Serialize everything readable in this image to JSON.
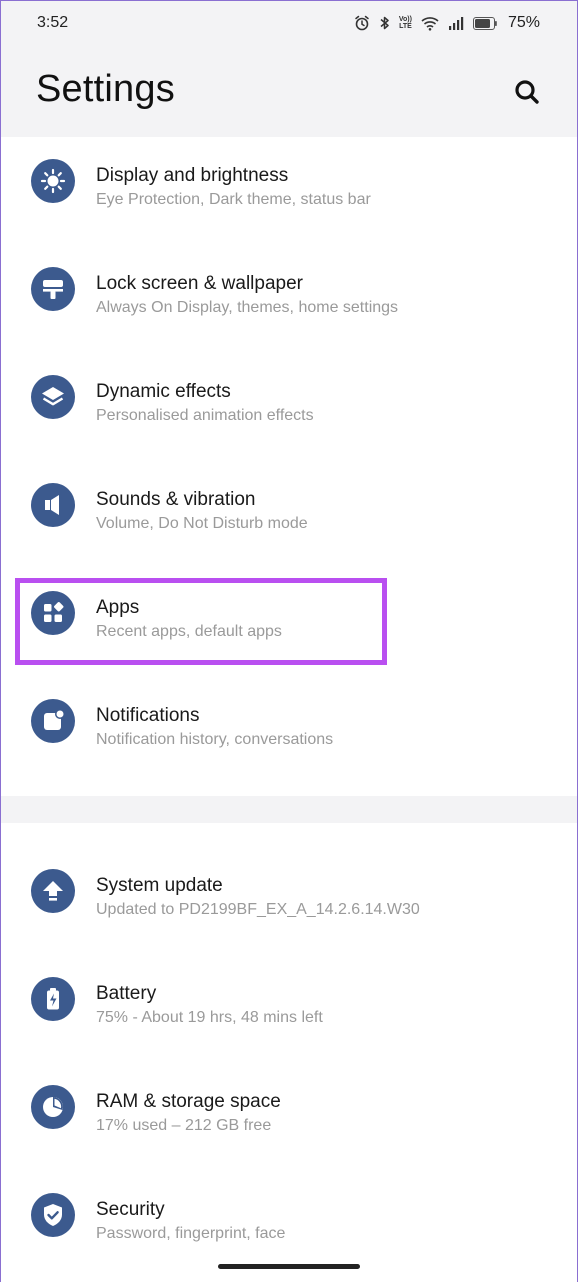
{
  "status_bar": {
    "time": "3:52",
    "volte_line1": "Vo))",
    "volte_line2": "LTE",
    "battery_percent": "75%",
    "icons": [
      "alarm-icon",
      "bluetooth-icon",
      "volte-icon",
      "wifi-icon",
      "signal-icon",
      "battery-icon"
    ]
  },
  "header": {
    "title": "Settings",
    "search_icon": "search-icon"
  },
  "settings_group_1": [
    {
      "title": "Display and brightness",
      "subtitle": "Eye Protection, Dark theme, status bar",
      "icon": "brightness-icon"
    },
    {
      "title": "Lock screen & wallpaper",
      "subtitle": "Always On Display, themes, home settings",
      "icon": "paint-roller-icon"
    },
    {
      "title": "Dynamic effects",
      "subtitle": "Personalised animation effects",
      "icon": "layers-icon"
    },
    {
      "title": "Sounds & vibration",
      "subtitle": "Volume, Do Not Disturb mode",
      "icon": "speaker-icon"
    },
    {
      "title": "Apps",
      "subtitle": "Recent apps, default apps",
      "icon": "apps-grid-icon"
    },
    {
      "title": "Notifications",
      "subtitle": "Notification history, conversations",
      "icon": "notification-badge-icon"
    }
  ],
  "settings_group_2": [
    {
      "title": "System update",
      "subtitle": "Updated to PD2199BF_EX_A_14.2.6.14.W30",
      "icon": "update-arrow-icon"
    },
    {
      "title": "Battery",
      "subtitle": "75% - About 19 hrs, 48 mins left",
      "icon": "battery-charge-icon"
    },
    {
      "title": "RAM & storage space",
      "subtitle": "17% used – 212 GB free",
      "icon": "pie-chart-icon"
    },
    {
      "title": "Security",
      "subtitle": "Password, fingerprint, face",
      "icon": "shield-check-icon"
    }
  ],
  "colors": {
    "icon_background": "#3c5a8e",
    "highlight_border": "#b94ff0",
    "header_background": "#f3f3f5"
  }
}
